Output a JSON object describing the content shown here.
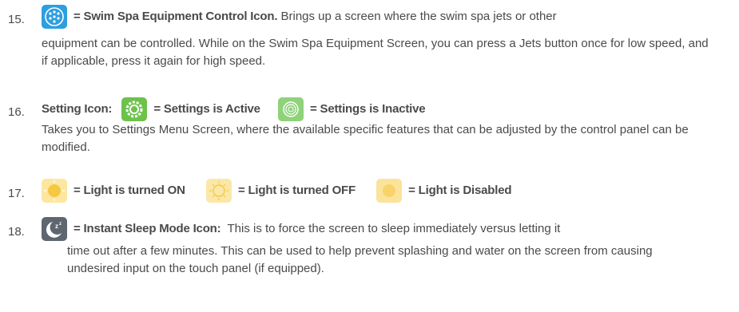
{
  "items": [
    {
      "number": "15.",
      "icon_name": "swim-spa-equipment-icon",
      "title": "= Swim Spa Equipment Control Icon.",
      "text_line1": " Brings up a screen where the swim spa jets or other",
      "text_rest": "equipment can be controlled. While on the Swim Spa Equipment Screen, you can press a Jets button once for low speed, and if applicable, press it again for high speed."
    },
    {
      "number": "16.",
      "label": "Setting Icon:",
      "active_icon": "settings-active-icon",
      "active_label": "= Settings is Active",
      "inactive_icon": "settings-inactive-icon",
      "inactive_label": "= Settings is Inactive",
      "text": "Takes you to Settings Menu Screen, where the available specific features that can be adjusted by the control panel can be modified."
    },
    {
      "number": "17.",
      "on_icon": "light-on-icon",
      "on_label": "= Light is turned ON",
      "off_icon": "light-off-icon",
      "off_label": "= Light is turned OFF",
      "disabled_icon": "light-disabled-icon",
      "disabled_label": "= Light is Disabled"
    },
    {
      "number": "18.",
      "icon_name": "instant-sleep-icon",
      "title": "= Instant Sleep Mode Icon:",
      "text_line1": "  This is to force the screen to sleep immediately versus letting it",
      "text_rest": "time out after a few minutes. This can be used to help prevent splashing and water on the screen from causing undesired input on the touch panel (if equipped)."
    }
  ],
  "colors": {
    "equipment_blue": "#2d9fe0",
    "settings_green": "#6cc24a",
    "settings_inactive": "#8fd27a",
    "light_yellow": "#f5c842",
    "light_off_bg": "#fbe8a8",
    "sleep_gray": "#5e6770"
  }
}
